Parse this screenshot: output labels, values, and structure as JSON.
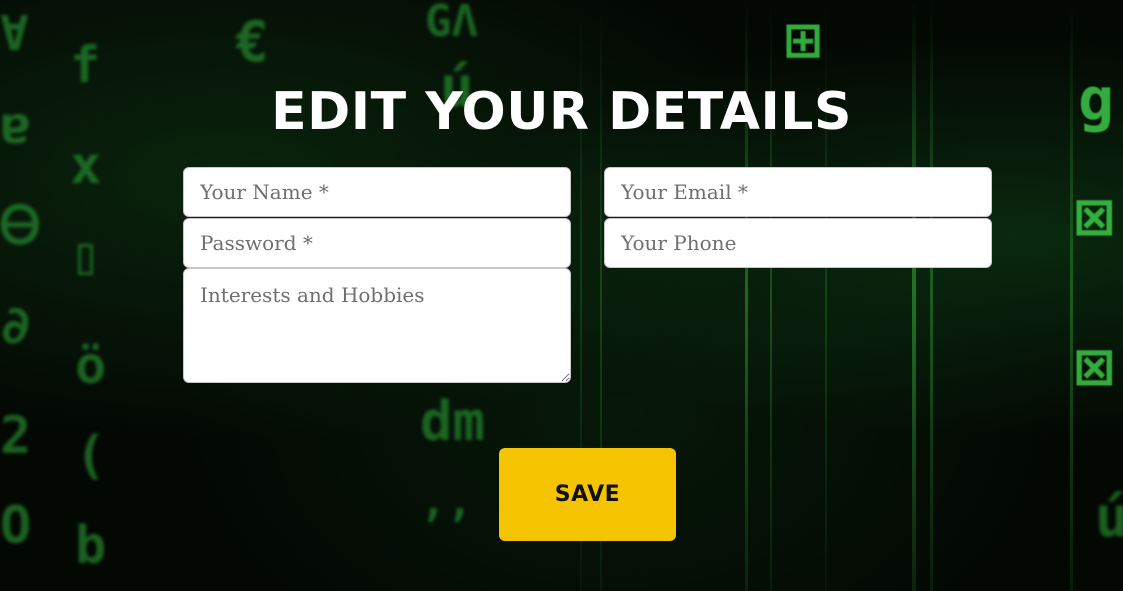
{
  "page": {
    "title": "EDIT YOUR DETAILS"
  },
  "form": {
    "name": {
      "value": "",
      "placeholder": "Your Name *"
    },
    "email": {
      "value": "",
      "placeholder": "Your Email *"
    },
    "password": {
      "value": "",
      "placeholder": "Password *"
    },
    "phone": {
      "value": "",
      "placeholder": "Your Phone"
    },
    "interests": {
      "value": "",
      "placeholder": "Interests and Hobbies"
    },
    "save_label": "SAVE"
  },
  "theme": {
    "accent": "#f5c400",
    "background": "#030803",
    "matrix_green": "#3fd34b"
  }
}
